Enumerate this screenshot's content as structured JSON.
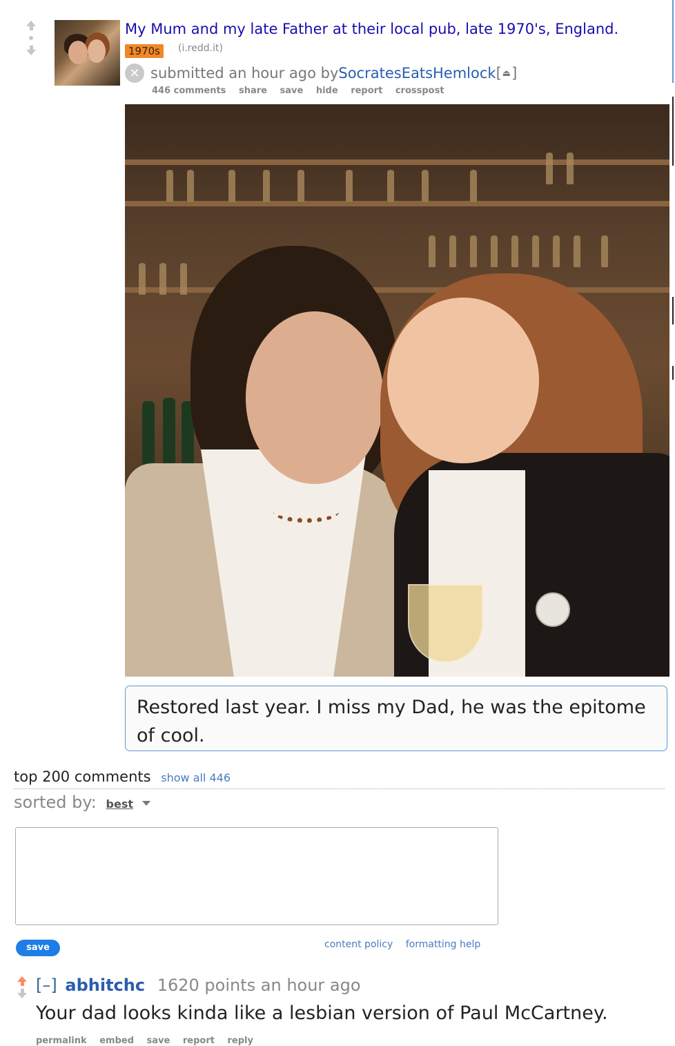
{
  "post": {
    "title": "My Mum and my late Father at their local pub, late 1970's, England.",
    "flair": "1970s",
    "domain": "(i.redd.it)",
    "submitted_prefix": "submitted an hour ago by ",
    "author": "SocratesEatsHemlock",
    "author_suffix_open": " [",
    "author_suffix_close": "]",
    "buttons": [
      "446 comments",
      "share",
      "save",
      "hide",
      "report",
      "crosspost"
    ],
    "selftext": "Restored last year. I miss my Dad, he was the epitome of cool."
  },
  "comments_header": {
    "title": "top 200 comments",
    "show_all": "show all 446",
    "sorted_label": "sorted by:",
    "sort_value": "best"
  },
  "comment_form": {
    "save_label": "save",
    "content_policy": "content policy",
    "formatting_help": "formatting help"
  },
  "comment": {
    "toggle": "[–]",
    "author": "abhitchc",
    "meta": "1620 points an hour ago",
    "body": "Your dad looks kinda like a lesbian version of Paul McCartney.",
    "buttons": [
      "permalink",
      "embed",
      "save",
      "report",
      "reply"
    ]
  },
  "colors": {
    "title_link": "#1a0dab",
    "author_link": "#2a5db0",
    "flair_bg": "#f0882a",
    "save_button": "#1e7ee6",
    "upvoted_arrow": "#ff8b60"
  }
}
